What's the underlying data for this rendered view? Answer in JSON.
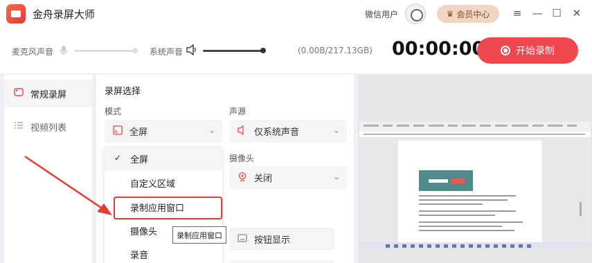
{
  "app": {
    "title": "金舟录屏大师",
    "user_label": "微信用户",
    "vip_label": "会员中心"
  },
  "window": {
    "menu_icon": "≡",
    "minimize_icon": "—",
    "maximize_icon": "☐",
    "close_icon": "✕"
  },
  "controls": {
    "mic_label": "麦克风声音",
    "sys_label": "系统声音",
    "mic_level": 0.0,
    "sys_level": 1.0,
    "storage": "(0.00B/217.13GB)",
    "timer": "00:00:00",
    "start_label": "开始录制"
  },
  "sidebar": {
    "items": [
      {
        "label": "常规录屏",
        "icon": "record-screen-icon"
      },
      {
        "label": "视频列表",
        "icon": "list-icon"
      }
    ]
  },
  "main": {
    "section_title": "录屏选择",
    "mode_label": "模式",
    "mode_value": "全屏",
    "audio_label": "声源",
    "audio_value": "仅系统声音",
    "camera_label": "摄像头",
    "camera_value": "关闭",
    "button_display_label": "按钮显示",
    "button_display_on": false
  },
  "dropdown": {
    "options": [
      "全屏",
      "自定义区域",
      "录制应用窗口",
      "摄像头",
      "录音"
    ],
    "selected": "全屏"
  },
  "tooltip": "录制应用窗口",
  "colors": {
    "accent": "#f0464e",
    "highlight": "#e73a30",
    "vip_bg": "#f1d6c1"
  }
}
